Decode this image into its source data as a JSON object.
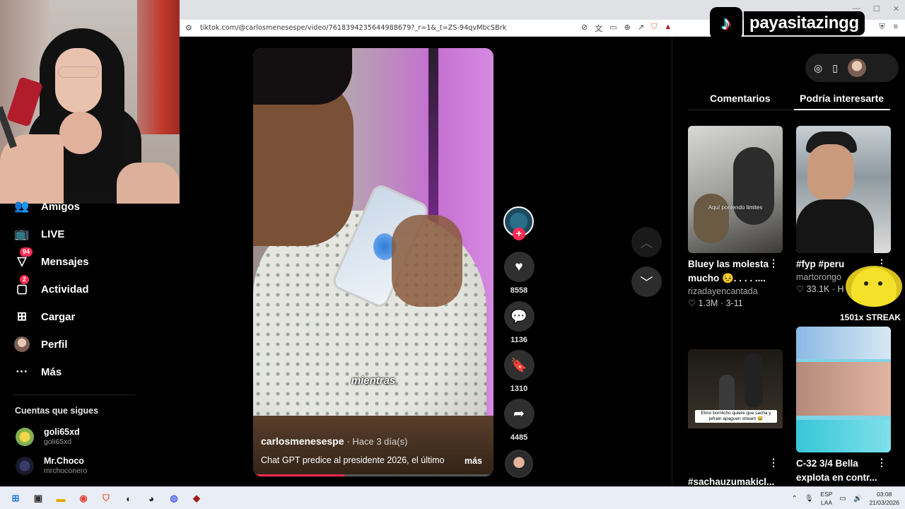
{
  "browser": {
    "url": "tiktok.com/@carlosmenesespe/video/7618394235644988679?_r=1&_t=ZS-94qvMbcSBrk"
  },
  "brand": {
    "name": "payasitazingg"
  },
  "sidebar": {
    "items": [
      {
        "label": "Amigos",
        "icon": "friends-icon"
      },
      {
        "label": "LIVE",
        "icon": "live-icon"
      },
      {
        "label": "Mensajes",
        "icon": "messages-icon",
        "badge": "94"
      },
      {
        "label": "Actividad",
        "icon": "activity-icon",
        "badge": "2"
      },
      {
        "label": "Cargar",
        "icon": "upload-icon"
      },
      {
        "label": "Perfil",
        "icon": "avatar"
      },
      {
        "label": "Más",
        "icon": "more-icon"
      }
    ],
    "following_title": "Cuentas que sigues",
    "following": [
      {
        "name": "goli65xd",
        "handle": "goli65xd"
      },
      {
        "name": "Mr.Choco",
        "handle": "mrchoconero"
      }
    ]
  },
  "video": {
    "subtitle": "mientras",
    "author": "carlosmenesespe",
    "date": "· Hace 3 día(s)",
    "description": "Chat GPT predice al presidente 2026, el último",
    "more": "más",
    "progress": 0.38
  },
  "actions": {
    "likes": "8558",
    "comments": "1136",
    "saves": "1310",
    "shares": "4485"
  },
  "right_panel": {
    "tabs": [
      "Comentarios",
      "Podría interesarte"
    ],
    "cards": [
      {
        "title": "Bluey las molesta mucho 😣. . . . ....",
        "author": "rizadayencantada",
        "stats": "♡ 1.3M · 3-11",
        "overlay": "Aquí poniendo limites"
      },
      {
        "title": "#fyp #peru",
        "author": "martorongo",
        "stats": "♡ 33.1K · H",
        "overlay": ""
      },
      {
        "title": "#sachauzumaki #sachauzumakicl...",
        "author": "",
        "stats": "",
        "overlay": "Elmo borr4cho quiere que sacha y jefrain apaguen stream 😂"
      },
      {
        "title": "C-32 3/4 Bella explota en contr...",
        "author": "",
        "stats": "",
        "overlay": ""
      }
    ]
  },
  "streak": {
    "label": "1501x STREAK"
  },
  "taskbar": {
    "lang_top": "ESP",
    "lang_bottom": "LAA",
    "time": "03:08",
    "date": "21/03/2026"
  }
}
